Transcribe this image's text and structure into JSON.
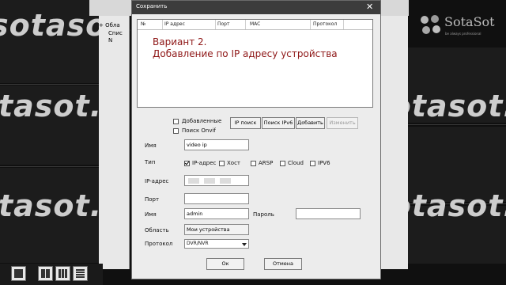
{
  "background": {
    "watermark_text": "tasot.c",
    "watermark_rows": [
      "sotasot.c",
      "tasot.c",
      "tasot.c"
    ]
  },
  "app": {
    "left_tree_items": [
      "+ Обла",
      "Спис",
      "N"
    ],
    "logo": {
      "name": "SotaSot",
      "tagline": "be always professional"
    },
    "layout_buttons": [
      "layout-1-icon",
      "layout-4-icon",
      "layout-9-icon",
      "layout-16-icon",
      "layout-custom-icon"
    ]
  },
  "dialog": {
    "title": "Сохранить",
    "close_glyph": "✕",
    "list_columns": [
      "№",
      "IP адрес",
      "Порт",
      "MAC",
      "Протокол"
    ],
    "overlay_text": [
      "Вариант 2.",
      "Добавление по IP адресу устройства"
    ],
    "checkbox_added": {
      "label": "Добавленные",
      "checked": false
    },
    "checkbox_onvif": {
      "label": "Поиск Onvif",
      "checked": false
    },
    "buttons": {
      "ip_search": "IP поиск",
      "ipv6_search": "Поиск IPv6",
      "add": "Добавить",
      "edit": "Изменить"
    },
    "fields": {
      "name_label": "Имя",
      "name_value": "video ip",
      "type_label": "Тип",
      "type_options": [
        {
          "label": "IP-адрес",
          "checked": true
        },
        {
          "label": "Хост",
          "checked": false
        },
        {
          "label": "ARSP",
          "checked": false
        },
        {
          "label": "Cloud",
          "checked": false
        },
        {
          "label": "IPV6",
          "checked": false
        }
      ],
      "ip_label": "IP-адрес",
      "port_label": "Порт",
      "port_value": "",
      "user_label": "Имя",
      "user_value": "admin",
      "password_label": "Пароль",
      "password_value": "",
      "area_label": "Область",
      "area_value": "Мои устройства",
      "protocol_label": "Протокол",
      "protocol_value": "DVR/NVR"
    },
    "ok": "Ок",
    "cancel": "Отмена"
  }
}
